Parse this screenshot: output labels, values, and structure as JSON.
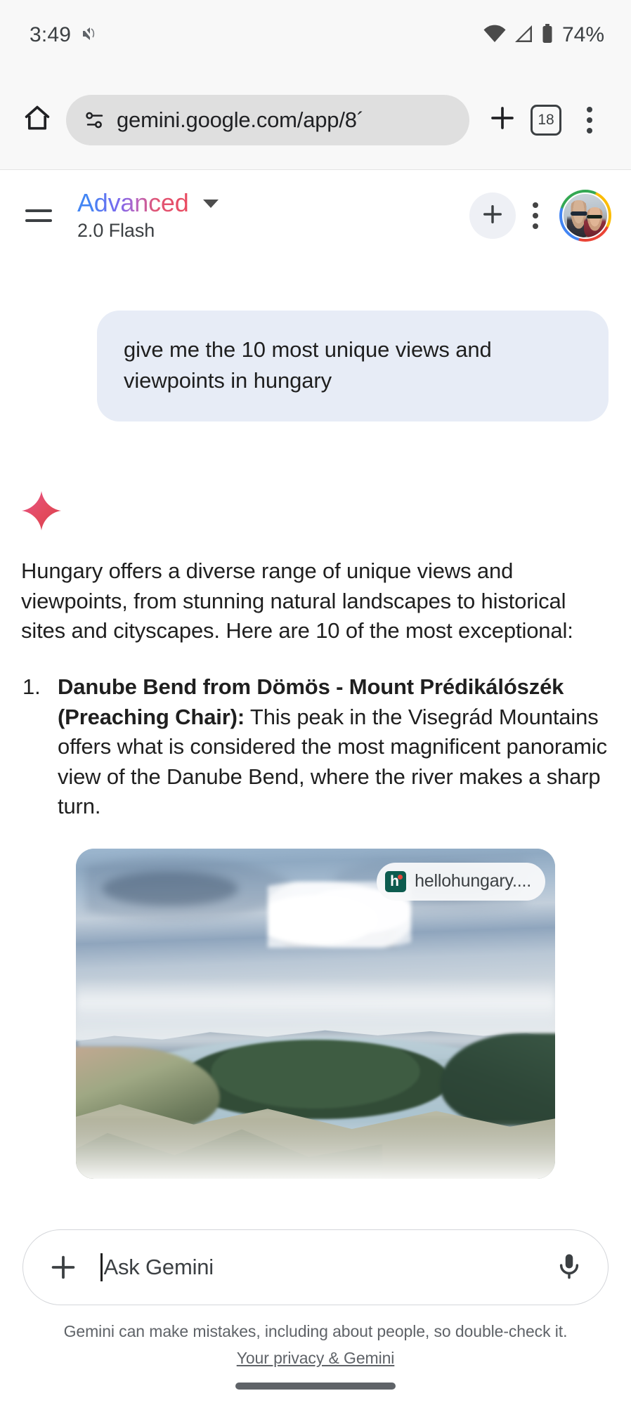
{
  "status_bar": {
    "time": "3:49",
    "notification_icon": "sound-off-icon",
    "wifi_icon": "wifi-icon",
    "signal_icon": "cell-signal-icon",
    "battery_icon": "battery-icon",
    "battery_text": "74%"
  },
  "browser": {
    "home_icon": "home-icon",
    "site_info_icon": "site-settings-icon",
    "url": "gemini.google.com/app/8´",
    "new_tab_icon": "plus-icon",
    "tab_count": "18",
    "menu_icon": "kebab-menu-icon"
  },
  "app_header": {
    "menu_icon": "hamburger-menu-icon",
    "model_name": "Advanced",
    "model_dropdown_icon": "chevron-down-icon",
    "model_version": "2.0 Flash",
    "new_chat_icon": "plus-icon",
    "overflow_icon": "kebab-menu-icon",
    "avatar": "account-avatar"
  },
  "conversation": {
    "user_message": "give me the 10 most unique views and viewpoints in hungary",
    "gemini_icon": "gemini-sparkle-icon",
    "response_intro": "Hungary offers a diverse range of unique views and viewpoints, from stunning natural landscapes to historical sites and cityscapes. Here are 10 of the most exceptional:",
    "list_items": [
      {
        "number": "1.",
        "title": "Danube Bend from Dömös - Mount Prédikálószék (Preaching Chair):",
        "body": " This peak in the Visegrád Mountains offers what is considered the most magnificent panoramic view of the Danube Bend, where the river makes a sharp turn."
      }
    ],
    "image_card": {
      "alt": "Aerial panoramic view of the Danube Bend with clouds over forested hills",
      "attribution_favicon": "hellohungary-favicon",
      "attribution_favicon_letter": "h",
      "attribution_text": "hellohungary...."
    }
  },
  "composer": {
    "attach_icon": "plus-icon",
    "placeholder": "Ask Gemini",
    "mic_icon": "microphone-icon"
  },
  "footer": {
    "disclaimer": "Gemini can make mistakes, including about people, so double-check it.",
    "privacy_link": "Your privacy & Gemini",
    "nav_pill": "home-gesture-bar"
  },
  "colors": {
    "user_bubble": "#e7ecf6",
    "toolbar_bg": "#f8f8f8",
    "omnibox_bg": "#dfdfdf",
    "accent_blue": "#4285f4",
    "accent_red": "#ea4335",
    "text_primary": "#1f1f1f",
    "text_secondary": "#5f6368"
  }
}
